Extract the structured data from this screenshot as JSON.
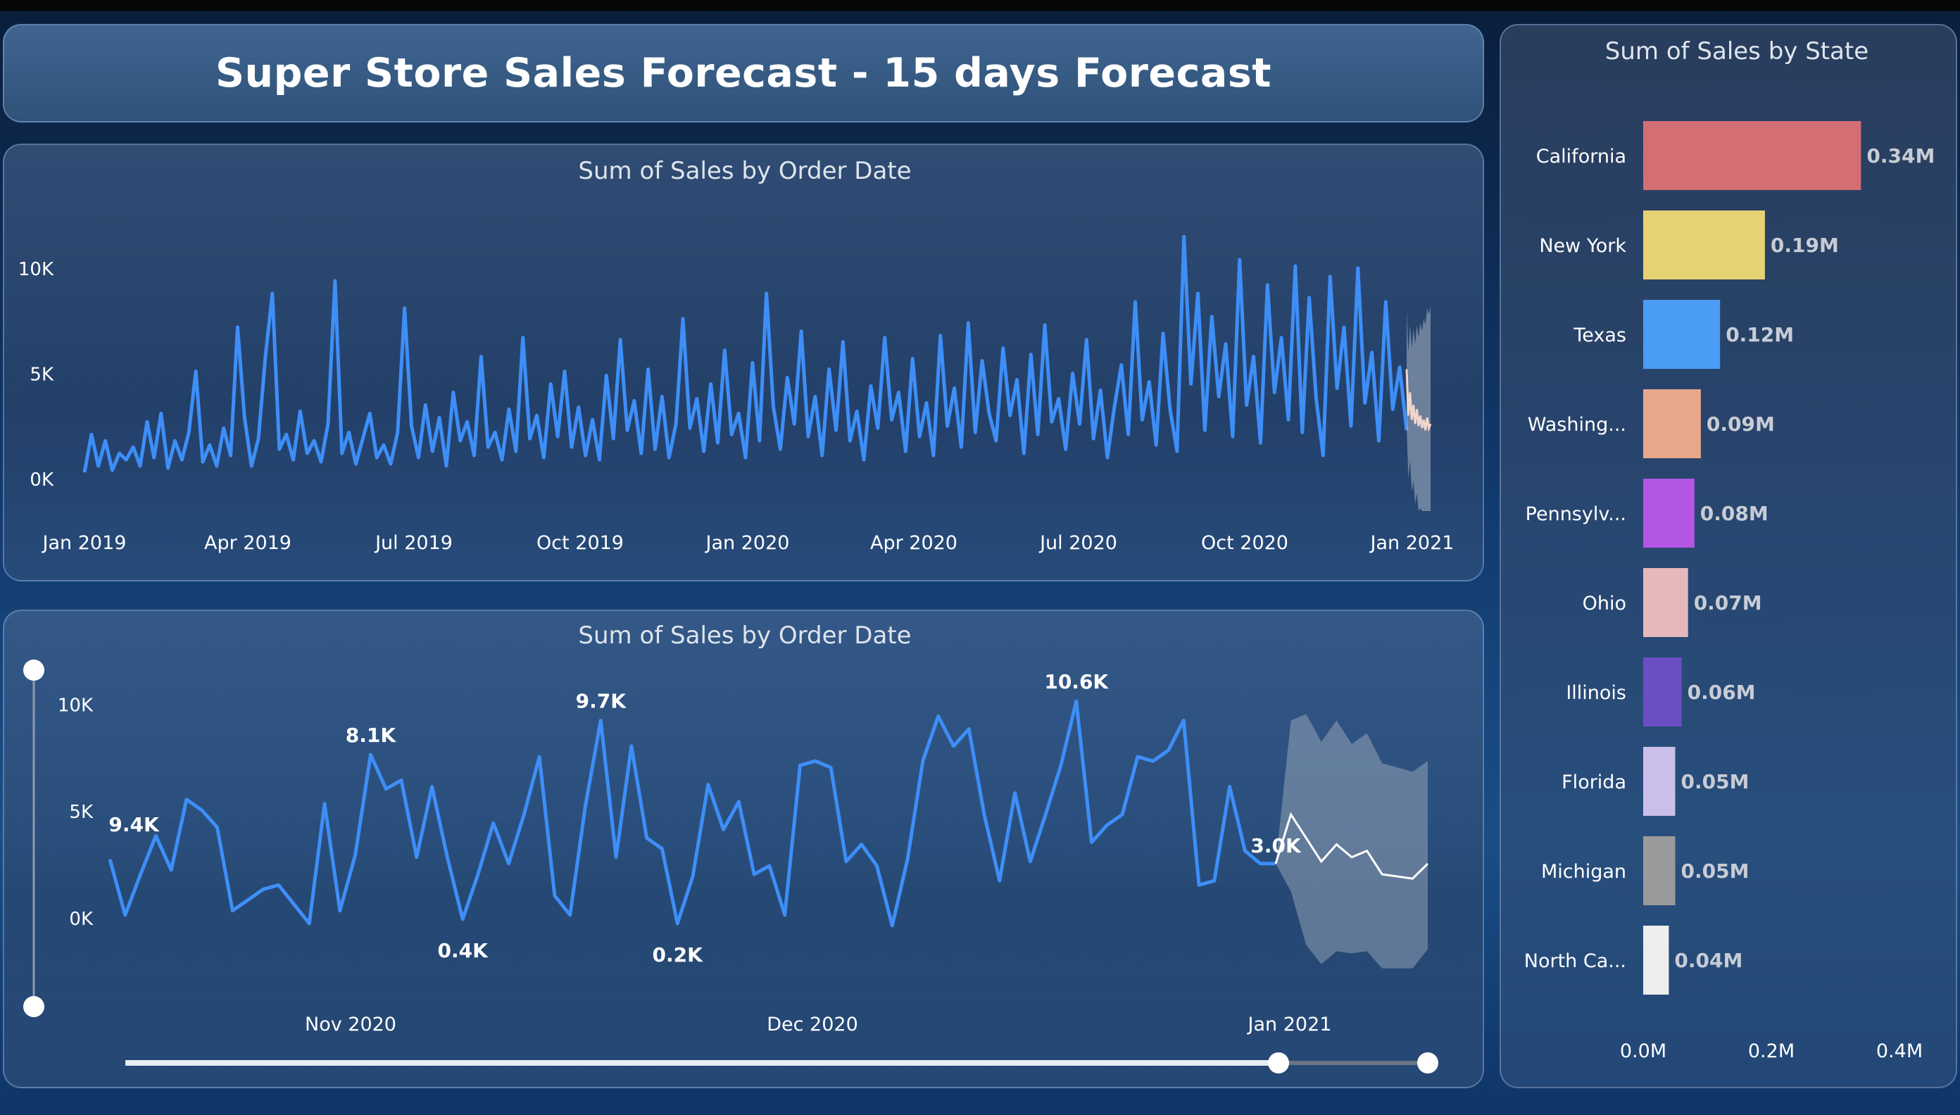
{
  "title": "Super Store Sales Forecast - 15 days Forecast",
  "colors": {
    "actual": "#3e8ef7",
    "forecast": "#ffffff",
    "band": "#a9b4c4"
  },
  "chart_data": [
    {
      "type": "line",
      "title": "Sum of Sales by Order Date",
      "x_tick_labels": [
        "Jan 2019",
        "Apr 2019",
        "Jul 2019",
        "Oct 2019",
        "Jan 2020",
        "Apr 2020",
        "Jul 2020",
        "Oct 2020",
        "Jan 2021"
      ],
      "y_tick_labels": [
        "0K",
        "5K",
        "10K"
      ],
      "ylim": [
        0,
        11000
      ],
      "x_range": [
        "2019-01-01",
        "2021-01-15"
      ],
      "series": [
        {
          "values": [
            300,
            2100,
            600,
            1800,
            400,
            1200,
            900,
            1500,
            600,
            2700,
            1000,
            3100,
            500,
            1800,
            900,
            2200,
            5100,
            800,
            1600,
            600,
            2400,
            1100,
            7200,
            2900,
            600,
            1900,
            5800,
            8800,
            1400,
            2100,
            900,
            3200,
            1200,
            1800,
            800,
            2600,
            9400,
            1200,
            2200,
            700,
            1900,
            3100,
            1000,
            1600,
            700,
            2200,
            8100,
            2500,
            1000,
            3500,
            1300,
            2900,
            600,
            4100,
            1800,
            2700,
            1100,
            5800,
            1500,
            2200,
            900,
            3300,
            1300,
            6700,
            1900,
            3000,
            1000,
            4500,
            2000,
            5100,
            1500,
            3400,
            1100,
            2800,
            900,
            4900,
            1900,
            6600,
            2300,
            3700,
            1200,
            5200,
            1400,
            3900,
            1000,
            2600,
            7600,
            2400,
            3800,
            1300,
            4500,
            1700,
            6100,
            2100,
            3100,
            1000,
            5500,
            1800,
            8800,
            3400,
            1400,
            4800,
            2600,
            7000,
            2000,
            3900,
            1100,
            5200,
            2300,
            6500,
            1800,
            3200,
            900,
            4400,
            2400,
            6700,
            2800,
            4100,
            1300,
            5700,
            2000,
            3600,
            1100,
            6800,
            2500,
            4300,
            1500,
            7400,
            2200,
            5600,
            3100,
            1800,
            6200,
            3000,
            4700,
            1200,
            5900,
            2100,
            7300,
            2700,
            3800,
            1400,
            5000,
            2600,
            6600,
            1900,
            4200,
            1000,
            3400,
            5400,
            2100,
            8400,
            2800,
            4600,
            1600,
            6900,
            3300,
            1300,
            11500,
            4500,
            8800,
            2300,
            7700,
            3900,
            6400,
            2000,
            10400,
            3500,
            5800,
            1700,
            9200,
            4100,
            6700,
            2800,
            10100,
            2200,
            8600,
            3800,
            1100,
            9600,
            4300,
            7200,
            2500,
            10000,
            3600,
            6000,
            1800,
            8400,
            3300,
            5300,
            2300
          ]
        },
        {
          "name": "",
          "values": [
            5200,
            3000,
            4100,
            2800,
            3500,
            2600,
            3300,
            2500,
            3000,
            2400,
            2800,
            2300,
            2900,
            2400,
            2600
          ]
        }
      ]
    },
    {
      "type": "line",
      "title": "Sum of Sales by Order Date",
      "x_tick_labels": [
        "Nov 2020",
        "Dec 2020",
        "Jan 2021"
      ],
      "y_tick_labels": [
        "0K",
        "5K",
        "10K"
      ],
      "ylim": [
        0,
        11000
      ],
      "data_labels": [
        "9.4K",
        "8.1K",
        "0.4K",
        "9.7K",
        "0.2K",
        "10.6K",
        "3.0K"
      ],
      "series": [
        {
          "values": [
            3200,
            600,
            2500,
            4300,
            2700,
            6000,
            5500,
            4700,
            800,
            1300,
            1800,
            2000,
            1100,
            200,
            5800,
            800,
            3400,
            8100,
            6500,
            6900,
            3300,
            6600,
            3300,
            400,
            2500,
            4900,
            3000,
            5300,
            8000,
            1500,
            600,
            5700,
            9700,
            3300,
            8500,
            4200,
            3700,
            200,
            2400,
            6700,
            4600,
            5900,
            2500,
            2900,
            600,
            7600,
            7800,
            7500,
            3100,
            3900,
            2900,
            100,
            3200,
            7800,
            9900,
            8500,
            9300,
            5300,
            2200,
            6300,
            3100,
            5300,
            7600,
            10600,
            4000,
            4800,
            5300,
            8000,
            7800,
            8300,
            9700,
            2000,
            2200,
            6600,
            3600,
            3000,
            3000
          ]
        },
        {
          "name": "",
          "values": [
            3000,
            5300,
            4200,
            3100,
            3900,
            3300,
            3600,
            2500,
            2400,
            2300,
            3000
          ]
        }
      ]
    },
    {
      "type": "bar",
      "orientation": "horizontal",
      "title": "Sum of Sales by State",
      "categories": [
        "California",
        "New York",
        "Texas",
        "Washing...",
        "Pennsylv...",
        "Ohio",
        "Illinois",
        "Florida",
        "Michigan",
        "North Ca..."
      ],
      "values": [
        0.34,
        0.19,
        0.12,
        0.09,
        0.08,
        0.07,
        0.06,
        0.05,
        0.05,
        0.04
      ],
      "value_labels": [
        "0.34M",
        "0.19M",
        "0.12M",
        "0.09M",
        "0.08M",
        "0.07M",
        "0.06M",
        "0.05M",
        "0.05M",
        "0.04M"
      ],
      "colors": [
        "#d26e74",
        "#e6d272",
        "#4a9cf5",
        "#e8a78a",
        "#b356e6",
        "#e7b8bb",
        "#6c4ec4",
        "#cbbfe9",
        "#9a9a9a",
        "#eeeeee"
      ],
      "x_tick_labels": [
        "0.0M",
        "0.2M",
        "0.4M"
      ],
      "xlim": [
        0,
        0.4
      ]
    }
  ]
}
